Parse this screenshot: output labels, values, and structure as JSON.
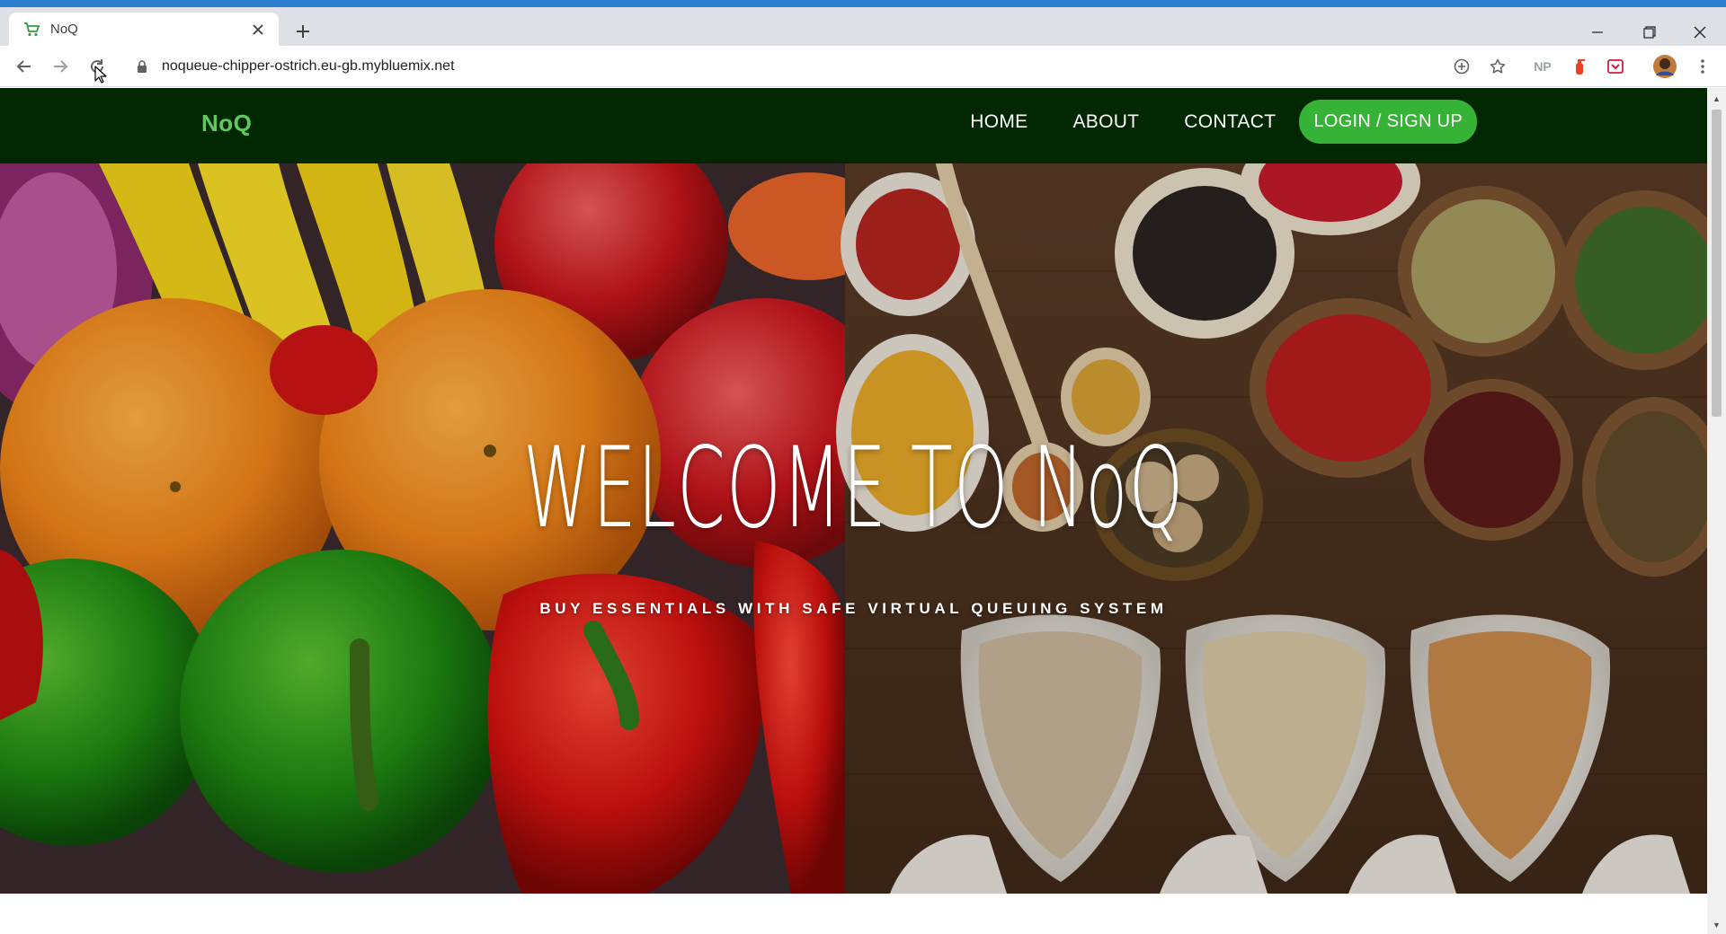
{
  "browser": {
    "tab": {
      "title": "NoQ",
      "favicon": "cart-icon",
      "close_icon": "close-icon"
    },
    "new_tab_icon": "plus-icon",
    "window_controls": [
      "minimize-icon",
      "restore-icon",
      "close-icon"
    ],
    "toolbar": {
      "back_icon": "arrow-left-icon",
      "forward_icon": "arrow-right-icon",
      "reload_icon": "reload-icon",
      "lock_icon": "lock-icon",
      "url": "noqueue-chipper-ostrich.eu-gb.mybluemix.net",
      "extensions": [
        "add-icon",
        "star-icon",
        "NP",
        "fire-extinguisher-icon",
        "pocket-icon",
        "avatar",
        "more-vert-icon"
      ]
    }
  },
  "site": {
    "brand": "NoQ",
    "nav": {
      "home": "HOME",
      "about": "ABOUT",
      "contact": "CONTACT",
      "login": "LOGIN / SIGN UP"
    },
    "hero": {
      "title": "WELCOME TO NoQ",
      "subtitle": "BUY ESSENTIALS WITH SAFE VIRTUAL QUEUING SYSTEM"
    },
    "colors": {
      "nav_bg": "#012701",
      "brand": "#5ec95e",
      "login_bg": "#36b336",
      "top_accent": "#2f7fd1"
    }
  }
}
